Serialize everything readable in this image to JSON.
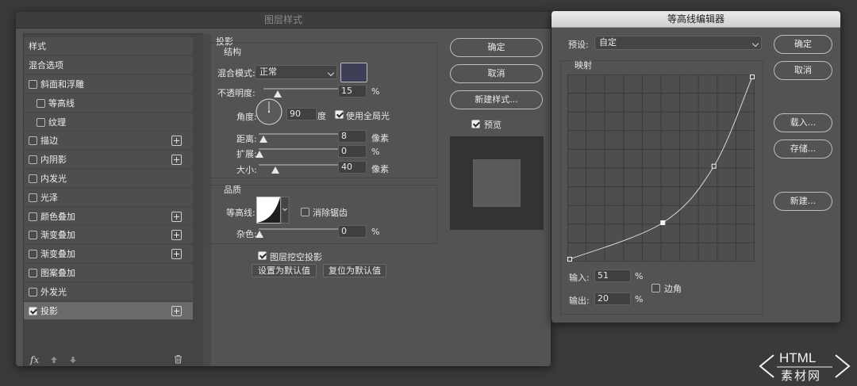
{
  "layer_style": {
    "title": "图层样式",
    "list": {
      "styles_label": "样式",
      "blend_label": "混合选项",
      "items": [
        {
          "label": "斜面和浮雕",
          "checked": false,
          "plus": false
        },
        {
          "label": "等高线",
          "checked": false,
          "plus": false,
          "indent": true
        },
        {
          "label": "纹理",
          "checked": false,
          "plus": false,
          "indent": true
        },
        {
          "label": "描边",
          "checked": false,
          "plus": true
        },
        {
          "label": "内阴影",
          "checked": false,
          "plus": true
        },
        {
          "label": "内发光",
          "checked": false,
          "plus": false
        },
        {
          "label": "光泽",
          "checked": false,
          "plus": false
        },
        {
          "label": "颜色叠加",
          "checked": false,
          "plus": true
        },
        {
          "label": "渐变叠加",
          "checked": false,
          "plus": true
        },
        {
          "label": "渐变叠加",
          "checked": false,
          "plus": true
        },
        {
          "label": "图案叠加",
          "checked": false,
          "plus": false
        },
        {
          "label": "外发光",
          "checked": false,
          "plus": false
        },
        {
          "label": "投影",
          "checked": true,
          "plus": true,
          "selected": true
        }
      ],
      "fx_label": "fx"
    },
    "drop_shadow": {
      "heading": "投影",
      "structure_heading": "结构",
      "blend_mode_label": "混合模式:",
      "blend_mode_value": "正常",
      "shadow_color": "#3d3f57",
      "opacity_label": "不透明度:",
      "opacity_value": "15",
      "opacity_unit": "%",
      "opacity_level": 15,
      "angle_label": "角度:",
      "angle_value": "90",
      "angle_unit": "度",
      "global_light_label": "使用全局光",
      "global_light_checked": true,
      "distance_label": "距离:",
      "distance_value": "8",
      "distance_unit": "像素",
      "spread_label": "扩展:",
      "spread_value": "0",
      "spread_unit": "%",
      "size_label": "大小:",
      "size_value": "40",
      "size_unit": "像素",
      "quality_heading": "品质",
      "contour_label": "等高线:",
      "antialias_label": "消除锯齿",
      "antialias_checked": false,
      "noise_label": "杂色:",
      "noise_value": "0",
      "noise_unit": "%",
      "knockout_label": "图层挖空投影",
      "knockout_checked": true,
      "set_default_label": "设置为默认值",
      "reset_default_label": "复位为默认值"
    },
    "buttons": {
      "ok": "确定",
      "cancel": "取消",
      "new_style": "新建样式...",
      "preview_label": "预览",
      "preview_checked": true
    }
  },
  "contour_editor": {
    "title": "等高线编辑器",
    "preset_label": "预设:",
    "preset_value": "自定",
    "mapping_label": "映射",
    "input_label": "输入:",
    "input_value": "51",
    "input_unit": "%",
    "output_label": "输出:",
    "output_value": "20",
    "output_unit": "%",
    "corner_label": "边角",
    "corner_checked": false,
    "buttons": {
      "ok": "确定",
      "cancel": "取消",
      "load": "载入...",
      "save": "存储...",
      "new": "新建..."
    },
    "curve_points": [
      {
        "input": 0,
        "output": 0
      },
      {
        "input": 51,
        "output": 20
      },
      {
        "input": 79,
        "output": 51
      },
      {
        "input": 100,
        "output": 100
      }
    ]
  },
  "watermark": {
    "text_top": "HTML",
    "text_bottom": "素材网"
  },
  "icons": [
    "checkbox-icon",
    "plus-icon",
    "fx-icon",
    "arrow-up-icon",
    "arrow-down-icon",
    "trash-icon",
    "chevron-down-icon",
    "angle-dial-icon",
    "contour-curve-icon"
  ]
}
